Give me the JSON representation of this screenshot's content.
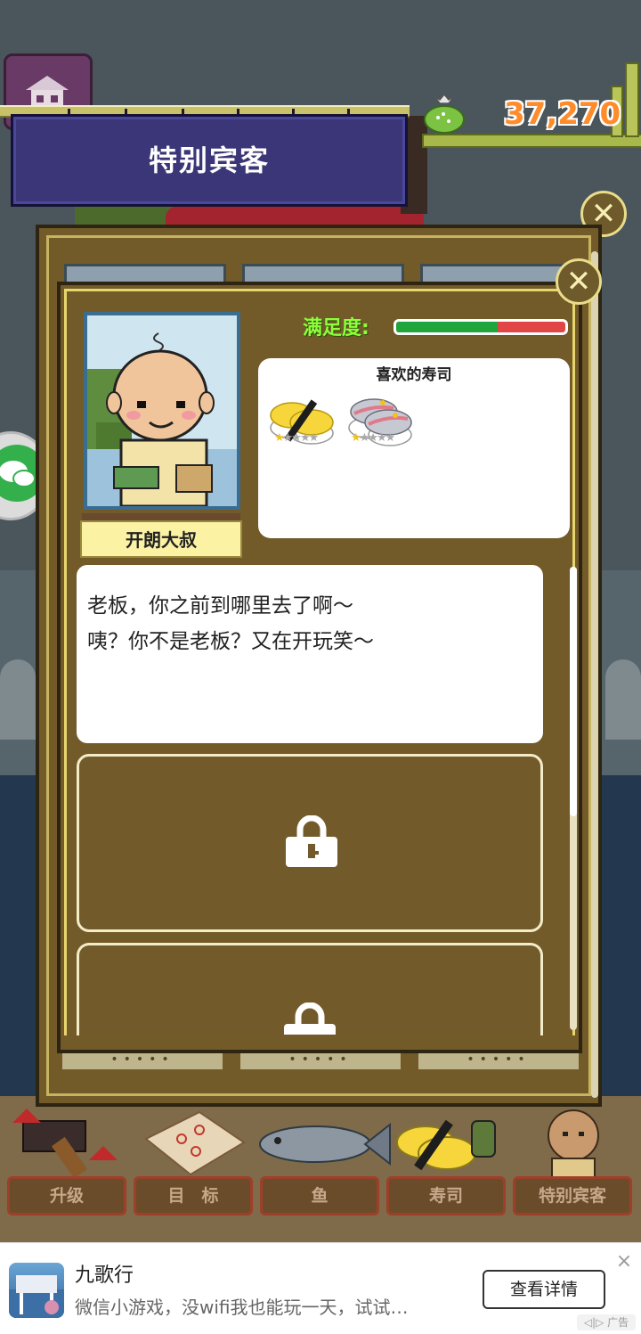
{
  "header": {
    "banner_title": "特别宾客",
    "coin_count": "37,270"
  },
  "customer": {
    "name": "开朗大叔",
    "satisfaction_label": "满足度:",
    "satisfaction_level": 0.6
  },
  "favorite_sushi": {
    "title": "喜欢的寿司",
    "items": [
      {
        "icon": "tamago-sushi-icon",
        "stars": 1,
        "max_stars": 5
      },
      {
        "icon": "aji-sushi-icon",
        "stars": 1,
        "max_stars": 5
      }
    ]
  },
  "dialogue": {
    "lines": [
      "老板，你之前到哪里去了啊～",
      "咦？你不是老板？又在开玩笑～"
    ]
  },
  "locked_slots": [
    {
      "icon": "padlock-icon"
    },
    {
      "icon": "padlock-icon"
    }
  ],
  "bottom_nav": {
    "upgrade": "升级",
    "goals": "目　标",
    "fish": "鱼",
    "sushi": "寿司",
    "special_guest": "特别宾客"
  },
  "ad": {
    "title": "九歌行",
    "description": "微信小游戏，没wifi我也能玩一天，试试…",
    "button": "查看详情",
    "tag": "广告"
  },
  "colors": {
    "panel_brown": "#725a29",
    "panel_gold_border": "#e7d56e",
    "banner_purple": "#3b3678",
    "satisfaction_green": "#1fa63a",
    "satisfaction_red": "#e24545",
    "coin_orange": "#ff8c2a",
    "label_green": "#8cff3a"
  }
}
